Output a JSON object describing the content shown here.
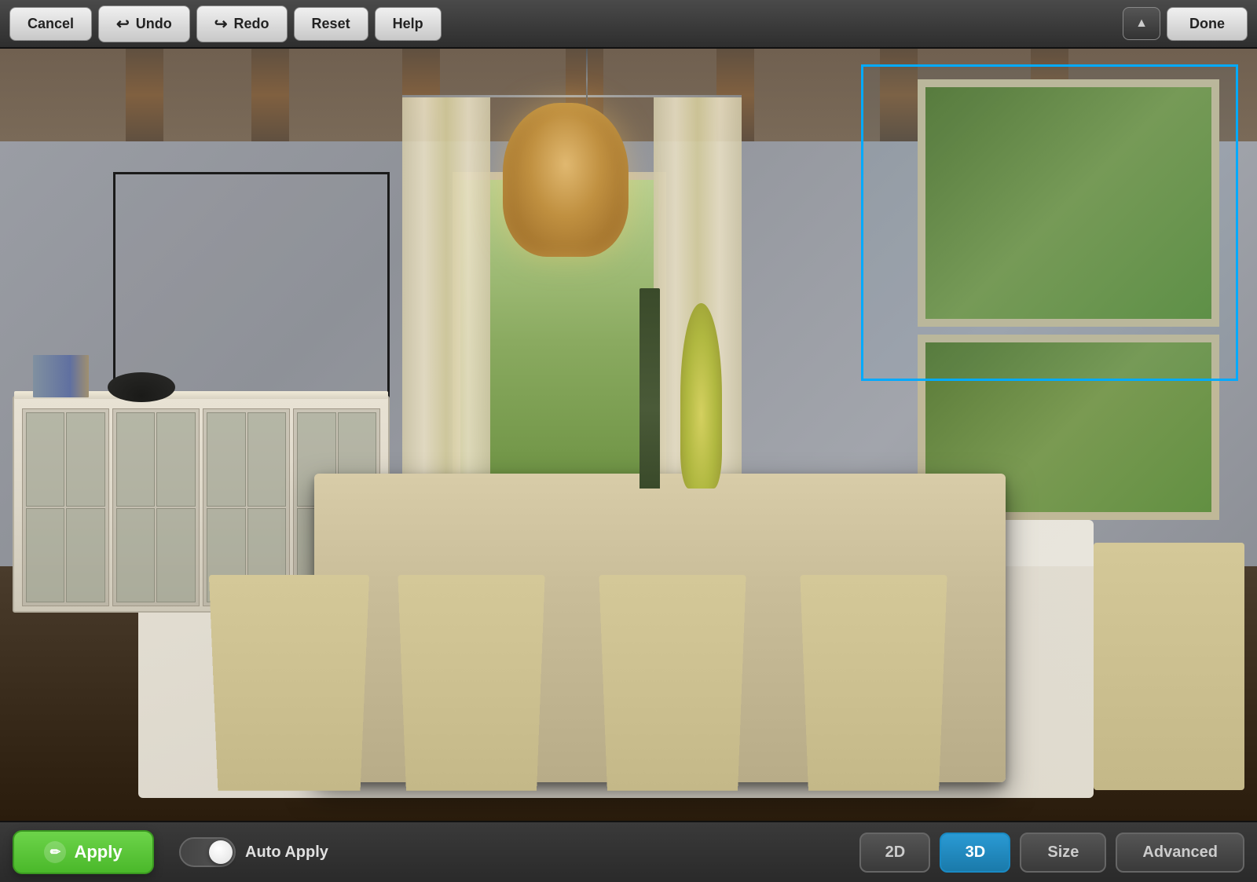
{
  "toolbar": {
    "cancel_label": "Cancel",
    "undo_label": "Undo",
    "redo_label": "Redo",
    "reset_label": "Reset",
    "help_label": "Help",
    "done_label": "Done",
    "collapse_icon": "▲"
  },
  "bottom_toolbar": {
    "apply_label": "Apply",
    "auto_apply_label": "Auto Apply",
    "btn_2d_label": "2D",
    "btn_3d_label": "3D",
    "size_label": "Size",
    "advanced_label": "Advanced"
  },
  "scene": {
    "has_selection": true,
    "selection_color": "#00aaff"
  },
  "icons": {
    "undo_icon": "↩",
    "redo_icon": "↪",
    "apply_icon": "✏",
    "toggle_on": true
  }
}
